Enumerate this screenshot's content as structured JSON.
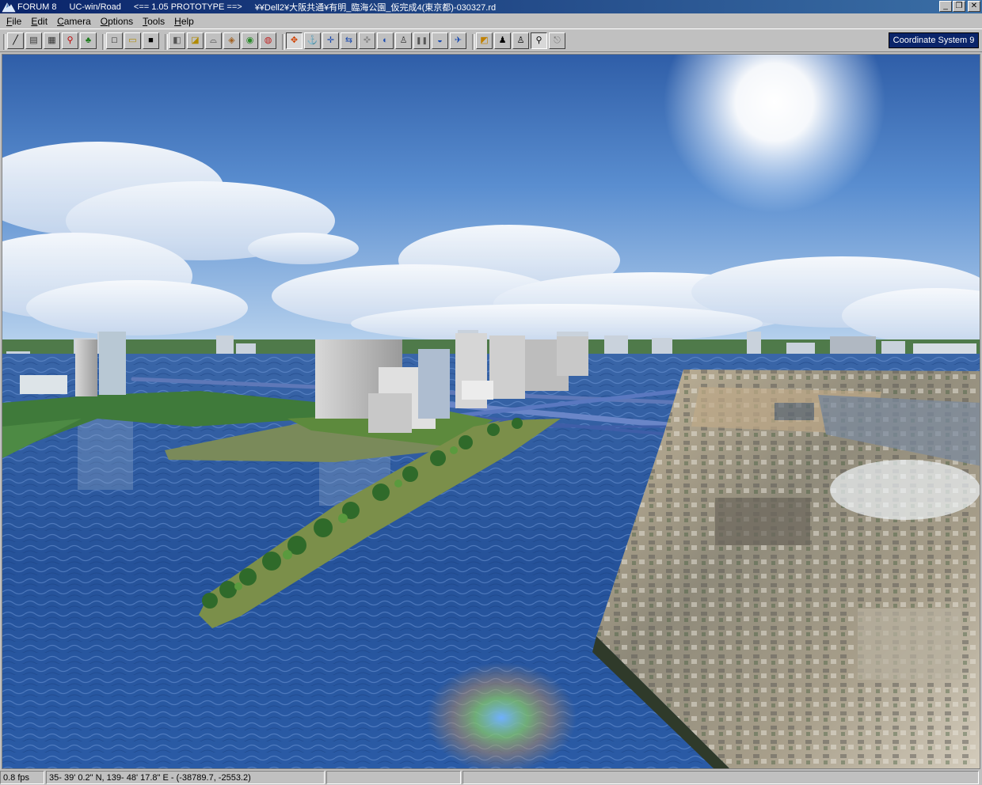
{
  "titlebar": {
    "app": "FORUM 8",
    "product": "UC-win/Road",
    "version_note": "<== 1.05 PROTOTYPE ==>",
    "file_path": "¥¥Dell2¥大阪共通¥有明_臨海公園_仮完成4(東京都)-030327.rd",
    "min_glyph": "_",
    "max_glyph": "❐",
    "close_glyph": "✕"
  },
  "menu": [
    {
      "key": "F",
      "rest": "ile"
    },
    {
      "key": "E",
      "rest": "dit"
    },
    {
      "key": "C",
      "rest": "amera"
    },
    {
      "key": "O",
      "rest": "ptions"
    },
    {
      "key": "T",
      "rest": "ools"
    },
    {
      "key": "H",
      "rest": "elp"
    }
  ],
  "toolbar": {
    "group1": [
      {
        "icon": "road-draw-icon",
        "glyph": "╱"
      },
      {
        "icon": "cross-section-icon",
        "glyph": "▤"
      },
      {
        "icon": "grid-pattern-icon",
        "glyph": "▦"
      },
      {
        "icon": "person-walk-icon",
        "glyph": "⚲"
      },
      {
        "icon": "tree-icon",
        "glyph": "♣"
      }
    ],
    "group2": [
      {
        "icon": "new-file-icon",
        "glyph": "□"
      },
      {
        "icon": "open-folder-icon",
        "glyph": "▭"
      },
      {
        "icon": "save-disk-icon",
        "glyph": "■"
      }
    ],
    "group3": [
      {
        "icon": "model-edit-icon",
        "glyph": "◧"
      },
      {
        "icon": "terrain-icon",
        "glyph": "◪"
      },
      {
        "icon": "bridge-icon",
        "glyph": "⌓"
      },
      {
        "icon": "texture-icon",
        "glyph": "◈"
      },
      {
        "icon": "landscape-icon",
        "glyph": "◉"
      },
      {
        "icon": "vehicle-icon",
        "glyph": "◍"
      }
    ],
    "group4": [
      {
        "icon": "rotate-camera-icon",
        "glyph": "✥"
      },
      {
        "icon": "anchor-icon",
        "glyph": "⚓"
      },
      {
        "icon": "move-cross-icon",
        "glyph": "✛"
      },
      {
        "icon": "pan-arrows-icon",
        "glyph": "⇆"
      },
      {
        "icon": "zoom-cross-icon",
        "glyph": "✜"
      },
      {
        "icon": "globe-icon",
        "glyph": "◐"
      },
      {
        "icon": "figure-icon",
        "glyph": "♙"
      },
      {
        "icon": "pause-icon",
        "glyph": "❚❚"
      },
      {
        "icon": "car-icon",
        "glyph": "◒"
      },
      {
        "icon": "airplane-icon",
        "glyph": "✈"
      }
    ],
    "group5": [
      {
        "icon": "sun-position-icon",
        "glyph": "◩"
      },
      {
        "icon": "driver-icon",
        "glyph": "♟"
      },
      {
        "icon": "pedestrian-icon",
        "glyph": "♙"
      },
      {
        "icon": "walking-man-icon",
        "glyph": "⚲"
      },
      {
        "icon": "exit-icon",
        "glyph": "⎋"
      }
    ],
    "coord_label": "Coordinate System 9"
  },
  "status": {
    "fps": "0.8 fps",
    "position": "35- 39' 0.2\" N, 139- 48' 17.8\" E  -  (-38789.7, -2553.2)",
    "panel3": "",
    "panel4": ""
  }
}
